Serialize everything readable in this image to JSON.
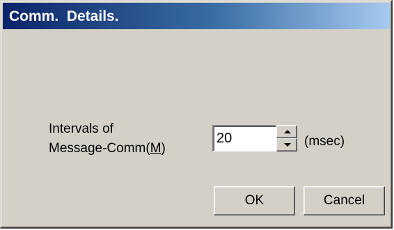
{
  "dialog": {
    "title": "Comm.  Details.",
    "field": {
      "label_line1": "Intervals of",
      "label_line2_prefix": "Message-Comm(",
      "label_mnemonic": "M",
      "label_line2_suffix": ")",
      "value": "20",
      "unit": "(msec)",
      "up_icon": "spin-up-arrow",
      "down_icon": "spin-down-arrow"
    },
    "buttons": {
      "ok_label": "OK",
      "cancel_label": "Cancel"
    }
  },
  "colors": {
    "face": "#d4d0c8",
    "title_start": "#0a246a",
    "title_end": "#a6caf0"
  }
}
